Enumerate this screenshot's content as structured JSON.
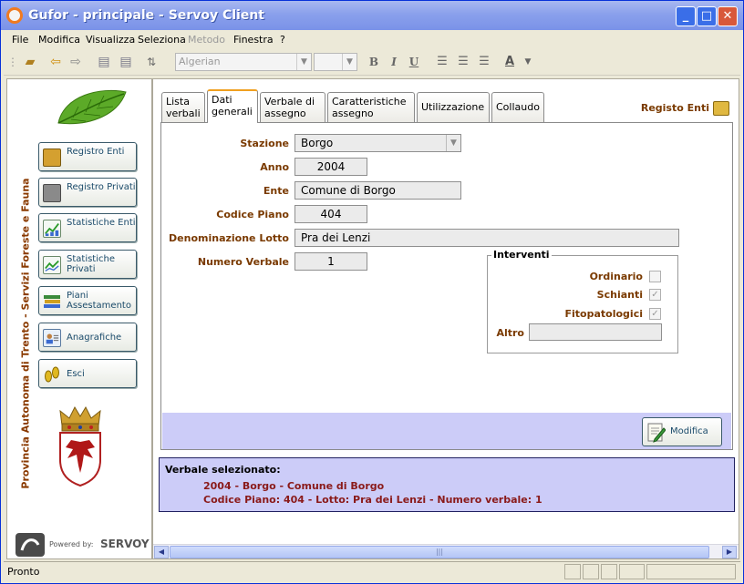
{
  "window": {
    "title": "Gufor - principale - Servoy Client",
    "minimize": "_",
    "maximize": "□",
    "close": "✕"
  },
  "menu": [
    {
      "label": "File",
      "enabled": true
    },
    {
      "label": "Modifica",
      "enabled": true
    },
    {
      "label": "Visualizza",
      "enabled": true
    },
    {
      "label": "Seleziona",
      "enabled": true
    },
    {
      "label": "Metodo",
      "enabled": false
    },
    {
      "label": "Finestra",
      "enabled": true
    },
    {
      "label": "?",
      "enabled": true
    }
  ],
  "toolbar": {
    "font_combo": "Algerian",
    "size_combo": "",
    "bold": "B",
    "italic": "I",
    "underline": "U",
    "font_color": "A"
  },
  "sidebar": {
    "vertical_text": "Provincia Autonoma di Trento - Servizi Foreste e Fauna",
    "buttons": [
      {
        "label": "Registro Enti",
        "icon": "book-icon"
      },
      {
        "label": "Registro Privati",
        "icon": "book-icon"
      },
      {
        "label": "Statistiche Enti",
        "icon": "chart-icon"
      },
      {
        "label": "Statistiche Privati",
        "icon": "chart-icon"
      },
      {
        "label": "Piani Assestamento",
        "icon": "books-icon"
      },
      {
        "label": "Anagrafiche",
        "icon": "id-card-icon"
      },
      {
        "label": "Esci",
        "icon": "footprints-icon"
      }
    ],
    "powered_by": "Powered by:",
    "servoy": "SERVOY"
  },
  "tabs": [
    {
      "label": "Lista verbali",
      "active": false
    },
    {
      "label": "Dati generali",
      "active": true
    },
    {
      "label": "Verbale di assegno",
      "active": false
    },
    {
      "label": "Caratteristiche assegno",
      "active": false
    },
    {
      "label": "Utilizzazione",
      "active": false
    },
    {
      "label": "Collaudo",
      "active": false
    }
  ],
  "registro_enti_link": "Registo Enti",
  "form": {
    "stazione_label": "Stazione",
    "stazione_value": "Borgo",
    "anno_label": "Anno",
    "anno_value": "2004",
    "ente_label": "Ente",
    "ente_value": "Comune di Borgo",
    "codice_label": "Codice Piano",
    "codice_value": "404",
    "lotto_label": "Denominazione Lotto",
    "lotto_value": "Pra dei Lenzi",
    "numero_label": "Numero Verbale",
    "numero_value": "1"
  },
  "interventi": {
    "legend": "Interventi",
    "ordinario_label": "Ordinario",
    "ordinario_checked": false,
    "schianti_label": "Schianti",
    "schianti_checked": true,
    "fito_label": "Fitopatologici",
    "fito_checked": true,
    "altro_label": "Altro",
    "altro_value": ""
  },
  "modifica_button": "Modifica",
  "selection": {
    "heading": "Verbale selezionato:",
    "line1": "2004 - Borgo - Comune di Borgo",
    "line2": "Codice Piano: 404 - Lotto: Pra dei Lenzi - Numero verbale: 1"
  },
  "status": {
    "text": "Pronto"
  },
  "colors": {
    "label_brown": "#7a3a00",
    "panel_lavender": "#ccccf8",
    "selection_red": "#8a1a1a"
  }
}
